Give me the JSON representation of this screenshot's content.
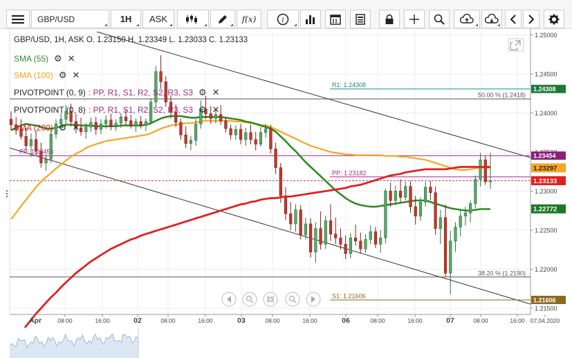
{
  "toolbar": {
    "symbol": "GBP/USD",
    "interval": "1H",
    "price_side": "ASK",
    "fx_label": "f(x)",
    "icons": [
      "menu-icon",
      "candlestick-icon",
      "draw-pencil-icon",
      "function-icon",
      "info-icon",
      "bar-chart-icon",
      "calendar-icon",
      "news-icon",
      "lock-icon",
      "crosshair-icon",
      "zoom-icon",
      "upload-cloud-icon",
      "download-cloud-icon",
      "chevron-left-icon",
      "chevron-right-icon",
      "gear-icon"
    ]
  },
  "legend": {
    "header": "GBP/USD, 1H, ASK   O. 1.23150 H. 1.23349 L. 1.23033 C. 1.23133",
    "indicators": [
      {
        "label": "SMA (55)",
        "color": "#2e8b22"
      },
      {
        "label": "SMA (100)",
        "color": "#f5a623"
      },
      {
        "label": "PIVOTPOINT (0, 9)",
        "tail": ": PP, R1, S1, R2, S2, R3, S3",
        "color": "#222222"
      },
      {
        "label": "PIVOTPOINT (0, 8)",
        "tail": ": PP, R1, S1, R2, S2, R3, S3",
        "color": "#222222"
      },
      {
        "label": "SMA (200)",
        "color": "#e02020"
      }
    ]
  },
  "chart_data": {
    "type": "candlestick",
    "y_range": [
      1.2142,
      1.2504
    ],
    "y_ticks": [
      "1.25000",
      "1.24500",
      "1.24000",
      "1.23500",
      "1.23000",
      "1.22500",
      "1.22000",
      "1.21500"
    ],
    "x_ticks": [
      "Apr",
      "08:00",
      "16:00",
      "02",
      "08:00",
      "16:00",
      "03",
      "08:00",
      "16:00",
      "06",
      "08:00",
      "16:00",
      "07",
      "08:00",
      "16:00",
      "07.04.2020"
    ],
    "candles": [
      [
        1.2392,
        1.2402,
        1.2378,
        1.2385
      ],
      [
        1.2385,
        1.2395,
        1.2372,
        1.2379
      ],
      [
        1.2379,
        1.2392,
        1.2366,
        1.237
      ],
      [
        1.237,
        1.2381,
        1.2352,
        1.2358
      ],
      [
        1.2358,
        1.2374,
        1.2344,
        1.2366
      ],
      [
        1.2366,
        1.2377,
        1.2346,
        1.2351
      ],
      [
        1.2351,
        1.2362,
        1.233,
        1.2336
      ],
      [
        1.2336,
        1.2347,
        1.2326,
        1.2341
      ],
      [
        1.2341,
        1.238,
        1.2336,
        1.2373
      ],
      [
        1.2373,
        1.2392,
        1.2367,
        1.2386
      ],
      [
        1.2386,
        1.24,
        1.2378,
        1.2392
      ],
      [
        1.2392,
        1.241,
        1.2386,
        1.2402
      ],
      [
        1.2402,
        1.2412,
        1.2383,
        1.2389
      ],
      [
        1.2389,
        1.2399,
        1.2374,
        1.2381
      ],
      [
        1.2381,
        1.2394,
        1.2371,
        1.2376
      ],
      [
        1.2376,
        1.2387,
        1.2367,
        1.2382
      ],
      [
        1.2382,
        1.2394,
        1.2376,
        1.2388
      ],
      [
        1.2388,
        1.2395,
        1.2372,
        1.2379
      ],
      [
        1.2379,
        1.2392,
        1.2373,
        1.2386
      ],
      [
        1.2386,
        1.2397,
        1.238,
        1.2391
      ],
      [
        1.2391,
        1.2399,
        1.2378,
        1.2383
      ],
      [
        1.2383,
        1.2392,
        1.2377,
        1.2387
      ],
      [
        1.2387,
        1.24,
        1.2381,
        1.2395
      ],
      [
        1.2395,
        1.2405,
        1.2384,
        1.239
      ],
      [
        1.239,
        1.2398,
        1.238,
        1.2384
      ],
      [
        1.2384,
        1.2393,
        1.2376,
        1.2389
      ],
      [
        1.2389,
        1.2396,
        1.238,
        1.2384
      ],
      [
        1.2384,
        1.2393,
        1.2377,
        1.2389
      ],
      [
        1.2389,
        1.2419,
        1.2385,
        1.2414
      ],
      [
        1.2414,
        1.246,
        1.2408,
        1.2453
      ],
      [
        1.2453,
        1.2474,
        1.2431,
        1.244
      ],
      [
        1.244,
        1.2447,
        1.2408,
        1.2414
      ],
      [
        1.2414,
        1.2423,
        1.2393,
        1.2401
      ],
      [
        1.2401,
        1.2411,
        1.2382,
        1.2388
      ],
      [
        1.2388,
        1.2393,
        1.2366,
        1.2372
      ],
      [
        1.2372,
        1.2383,
        1.2355,
        1.2361
      ],
      [
        1.2361,
        1.2371,
        1.2352,
        1.2365
      ],
      [
        1.2365,
        1.2392,
        1.2358,
        1.2386
      ],
      [
        1.2386,
        1.2416,
        1.238,
        1.2405
      ],
      [
        1.2405,
        1.2422,
        1.2392,
        1.2399
      ],
      [
        1.2399,
        1.2409,
        1.2386,
        1.2393
      ],
      [
        1.2393,
        1.2405,
        1.2387,
        1.2398
      ],
      [
        1.2398,
        1.241,
        1.2385,
        1.239
      ],
      [
        1.239,
        1.2394,
        1.2375,
        1.238
      ],
      [
        1.238,
        1.2385,
        1.2366,
        1.2372
      ],
      [
        1.2372,
        1.2384,
        1.2366,
        1.2379
      ],
      [
        1.2379,
        1.2386,
        1.236,
        1.2366
      ],
      [
        1.2366,
        1.2381,
        1.2358,
        1.2375
      ],
      [
        1.2375,
        1.2385,
        1.236,
        1.2366
      ],
      [
        1.2366,
        1.2376,
        1.2352,
        1.236
      ],
      [
        1.236,
        1.2382,
        1.2357,
        1.2375
      ],
      [
        1.2375,
        1.2386,
        1.2368,
        1.238
      ],
      [
        1.238,
        1.2385,
        1.2348,
        1.2354
      ],
      [
        1.2354,
        1.2362,
        1.2322,
        1.233
      ],
      [
        1.233,
        1.2336,
        1.2285,
        1.2294
      ],
      [
        1.2294,
        1.2305,
        1.2263,
        1.2271
      ],
      [
        1.2271,
        1.2286,
        1.225,
        1.2258
      ],
      [
        1.2258,
        1.2283,
        1.2248,
        1.2276
      ],
      [
        1.2276,
        1.2282,
        1.2238,
        1.2244
      ],
      [
        1.2244,
        1.2266,
        1.2238,
        1.2258
      ],
      [
        1.2258,
        1.2265,
        1.2215,
        1.2222
      ],
      [
        1.2222,
        1.226,
        1.2208,
        1.2252
      ],
      [
        1.2252,
        1.2274,
        1.2225,
        1.2232
      ],
      [
        1.2232,
        1.2268,
        1.2226,
        1.2262
      ],
      [
        1.2262,
        1.2283,
        1.2236,
        1.2245
      ],
      [
        1.2245,
        1.2266,
        1.2232,
        1.224
      ],
      [
        1.224,
        1.2252,
        1.2225,
        1.2232
      ],
      [
        1.2232,
        1.2243,
        1.2213,
        1.222
      ],
      [
        1.222,
        1.2246,
        1.2214,
        1.224
      ],
      [
        1.224,
        1.2257,
        1.223,
        1.2236
      ],
      [
        1.2236,
        1.2247,
        1.222,
        1.2226
      ],
      [
        1.2226,
        1.2245,
        1.2221,
        1.2238
      ],
      [
        1.2238,
        1.2256,
        1.2232,
        1.2248
      ],
      [
        1.2248,
        1.2254,
        1.2227,
        1.2232
      ],
      [
        1.2232,
        1.225,
        1.2221,
        1.224
      ],
      [
        1.224,
        1.2303,
        1.2233,
        1.23
      ],
      [
        1.23,
        1.2311,
        1.228,
        1.2288
      ],
      [
        1.2288,
        1.2307,
        1.2282,
        1.23
      ],
      [
        1.23,
        1.2315,
        1.2285,
        1.2292
      ],
      [
        1.2292,
        1.2312,
        1.2288,
        1.2306
      ],
      [
        1.2306,
        1.2313,
        1.2272,
        1.228
      ],
      [
        1.228,
        1.2294,
        1.2257,
        1.2268
      ],
      [
        1.2268,
        1.2292,
        1.2262,
        1.2286
      ],
      [
        1.2286,
        1.2312,
        1.228,
        1.2305
      ],
      [
        1.2305,
        1.2313,
        1.2288,
        1.2298
      ],
      [
        1.2298,
        1.2306,
        1.2244,
        1.2252
      ],
      [
        1.2252,
        1.2276,
        1.2232,
        1.2266
      ],
      [
        1.2266,
        1.2283,
        1.219,
        1.2195
      ],
      [
        1.2195,
        1.2249,
        1.2168,
        1.2236
      ],
      [
        1.2236,
        1.226,
        1.2222,
        1.2254
      ],
      [
        1.2254,
        1.2276,
        1.2242,
        1.2268
      ],
      [
        1.2268,
        1.228,
        1.2256,
        1.2272
      ],
      [
        1.2272,
        1.2288,
        1.226,
        1.2284
      ],
      [
        1.2284,
        1.232,
        1.2278,
        1.2315
      ],
      [
        1.2315,
        1.2349,
        1.2306,
        1.234
      ],
      [
        1.234,
        1.2345,
        1.2308,
        1.2312
      ],
      [
        1.2312,
        1.2349,
        1.2303,
        1.2313
      ]
    ],
    "sma55": [
      1.2378,
      1.2381,
      1.2384,
      1.2386,
      1.2385,
      1.2384,
      1.2382,
      1.238,
      1.238,
      1.2381,
      1.2383,
      1.2385,
      1.2385,
      1.2385,
      1.2384,
      1.2384,
      1.2384,
      1.2383,
      1.2383,
      1.2383,
      1.2383,
      1.2383,
      1.2384,
      1.2384,
      1.2384,
      1.2384,
      1.2384,
      1.2385,
      1.2387,
      1.239,
      1.2393,
      1.2395,
      1.2396,
      1.2396,
      1.2396,
      1.2395,
      1.2394,
      1.2394,
      1.2395,
      1.2395,
      1.2395,
      1.2395,
      1.2395,
      1.2394,
      1.2393,
      1.2392,
      1.2391,
      1.2389,
      1.2388,
      1.2386,
      1.2384,
      1.2382,
      1.238,
      1.2376,
      1.237,
      1.2364,
      1.2357,
      1.2351,
      1.2344,
      1.2337,
      1.2331,
      1.2325,
      1.2319,
      1.2313,
      1.2307,
      1.2301,
      1.2296,
      1.2291,
      1.2287,
      1.2284,
      1.2282,
      1.2281,
      1.228,
      1.228,
      1.2281,
      1.2282,
      1.2283,
      1.2284,
      1.2285,
      1.2286,
      1.2287,
      1.2288,
      1.2288,
      1.2288,
      1.2286,
      1.2284,
      1.2282,
      1.228,
      1.2278,
      1.2277,
      1.2276,
      1.2275,
      1.2275,
      1.2276,
      1.2277,
      1.2277,
      1.2277
    ],
    "sma100": [
      1.2264,
      1.2272,
      1.2281,
      1.2289,
      1.2297,
      1.2305,
      1.2312,
      1.2318,
      1.2323,
      1.2329,
      1.2334,
      1.2339,
      1.2344,
      1.2348,
      1.2351,
      1.2355,
      1.2358,
      1.236,
      1.2362,
      1.2364,
      1.2365,
      1.2366,
      1.2367,
      1.2368,
      1.2369,
      1.237,
      1.2371,
      1.2372,
      1.2374,
      1.2377,
      1.238,
      1.2382,
      1.2384,
      1.2385,
      1.2386,
      1.2387,
      1.2387,
      1.2388,
      1.2389,
      1.239,
      1.239,
      1.239,
      1.239,
      1.239,
      1.239,
      1.2389,
      1.2389,
      1.2388,
      1.2387,
      1.2386,
      1.2385,
      1.2384,
      1.2382,
      1.2379,
      1.2376,
      1.2373,
      1.237,
      1.2367,
      1.2364,
      1.2361,
      1.2358,
      1.2356,
      1.2354,
      1.2352,
      1.235,
      1.2349,
      1.2348,
      1.2347,
      1.2347,
      1.2346,
      1.2346,
      1.2346,
      1.2346,
      1.2346,
      1.2346,
      1.2345,
      1.2345,
      1.2345,
      1.2344,
      1.2344,
      1.2343,
      1.2342,
      1.2341,
      1.234,
      1.2338,
      1.2336,
      1.2334,
      1.2332,
      1.233,
      1.2328,
      1.2327,
      1.2327,
      1.2328,
      1.2329,
      1.233,
      1.233,
      1.233
    ],
    "sma200": [
      1.2103,
      1.2111,
      1.2119,
      1.2127,
      1.2135,
      1.2143,
      1.215,
      1.2157,
      1.2164,
      1.217,
      1.2177,
      1.2183,
      1.2189,
      1.2195,
      1.22,
      1.2205,
      1.221,
      1.2214,
      1.2218,
      1.2222,
      1.2226,
      1.2229,
      1.2232,
      1.2235,
      1.2238,
      1.224,
      1.2243,
      1.2245,
      1.2247,
      1.2249,
      1.2251,
      1.2253,
      1.2255,
      1.2257,
      1.2259,
      1.2261,
      1.2263,
      1.2265,
      1.2267,
      1.2269,
      1.2271,
      1.2273,
      1.2275,
      1.2277,
      1.2279,
      1.2281,
      1.2283,
      1.2284,
      1.2286,
      1.2287,
      1.2289,
      1.229,
      1.2291,
      1.2291,
      1.2292,
      1.2293,
      1.2293,
      1.2294,
      1.2295,
      1.2296,
      1.2297,
      1.2298,
      1.2299,
      1.23,
      1.2301,
      1.2302,
      1.2303,
      1.2304,
      1.2306,
      1.2307,
      1.2308,
      1.231,
      1.2312,
      1.2314,
      1.2316,
      1.2318,
      1.232,
      1.2321,
      1.2322,
      1.2324,
      1.2325,
      1.2326,
      1.2327,
      1.2328,
      1.2328,
      1.2328,
      1.2328,
      1.2328,
      1.2329,
      1.233,
      1.2331,
      1.2331,
      1.2331,
      1.2331,
      1.2331,
      1.2331,
      1.2331
    ],
    "hlines": [
      {
        "label": "R1: 1.24308",
        "value": 1.24308,
        "color": "#1b8a7a",
        "tag": "1.24308",
        "tag_bg": "#1b7a3a"
      },
      {
        "label": "50.00 % (1.2418)",
        "value": 1.2418,
        "color": "#555555"
      },
      {
        "label": "PP: 1.23454",
        "value": 1.23454,
        "color": "#a0288c",
        "tag": "1.23454",
        "tag_bg": "#8a1f7a"
      },
      {
        "label": "PP: 1.23182",
        "value": 1.23182,
        "color": "#a0288c"
      },
      {
        "label": "38.20 % (1.2190)",
        "value": 1.219,
        "color": "#555555"
      },
      {
        "label": "S1: 1.21606",
        "value": 1.21606,
        "color": "#8a6a1f",
        "tag": "1.21606",
        "tag_bg": "#8a6a1f"
      }
    ],
    "price_tags": [
      {
        "label": "1.23297",
        "value": 1.23297,
        "bg": "#f5a623",
        "fg": "#222222"
      },
      {
        "label": "1.23133",
        "value": 1.23133,
        "bg": "#e02020",
        "fg": "#ffffff"
      },
      {
        "label": "1.22772",
        "value": 1.22772,
        "bg": "#1e7a22",
        "fg": "#ffffff"
      }
    ],
    "colors": {
      "up": "#5aa86b",
      "down": "#c0392b",
      "up_border": "#2d6e3c",
      "down_border": "#7a1f1a"
    }
  }
}
